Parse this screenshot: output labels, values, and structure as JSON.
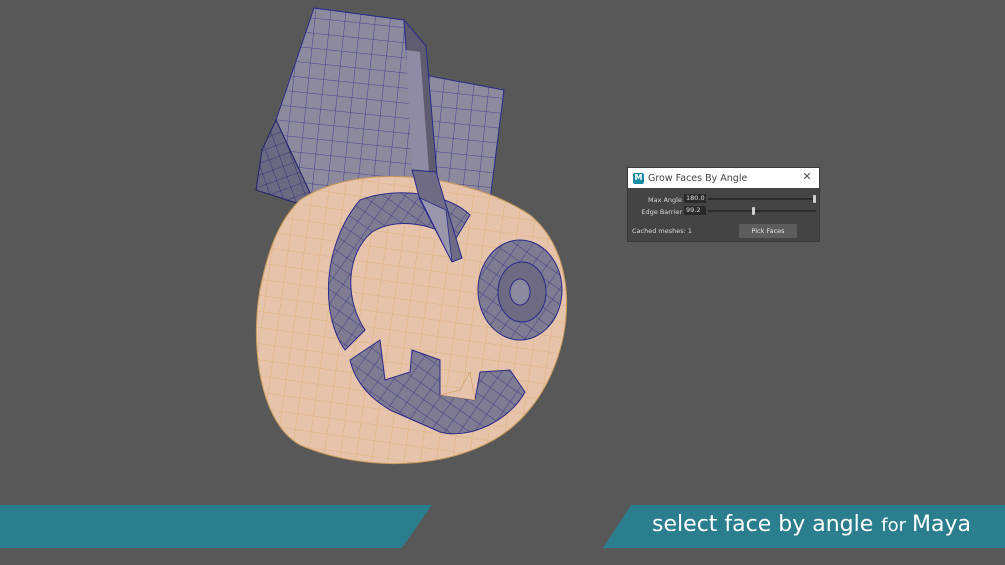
{
  "viewport": {
    "background": "#585858",
    "model": {
      "description_icon": "mesh-object",
      "selected_color": "#e8c6ae",
      "wire_color": "#2a2a8a",
      "base_color": "#8f8aa0"
    }
  },
  "tool_window": {
    "title": "Grow Faces By Angle",
    "icon_letter": "M",
    "close_glyph": "✕",
    "max_angle_label": "Max Angle",
    "max_angle_value": "180.0",
    "max_angle_fraction": 1.0,
    "edge_barrier_label": "Edge Barrier",
    "edge_barrier_value": "99.2",
    "edge_barrier_fraction": 0.42,
    "cached_label": "Cached meshes: 1",
    "pick_button_label": "Pick Faces"
  },
  "banner": {
    "main": "select face by angle",
    "small": "for",
    "big": "Maya",
    "color": "#2b7e8e"
  }
}
